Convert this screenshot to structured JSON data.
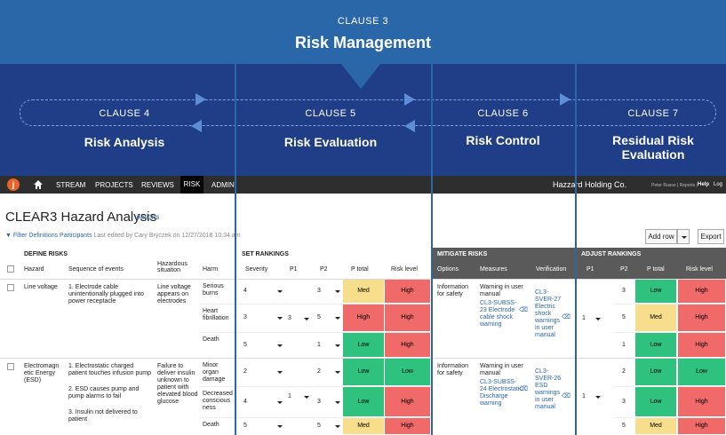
{
  "banner": {
    "clause_top": "CLAUSE 3",
    "title": "Risk Management",
    "clauses": [
      {
        "num": "CLAUSE 4",
        "name": "Risk Analysis"
      },
      {
        "num": "CLAUSE 5",
        "name": "Risk Evaluation"
      },
      {
        "num": "CLAUSE 6",
        "name": "Risk Control"
      },
      {
        "num": "CLAUSE 7",
        "name": "Residual Risk Evaluation"
      }
    ]
  },
  "nav": {
    "logo": "j",
    "items": [
      "STREAM",
      "PROJECTS",
      "REVIEWS",
      "RISK",
      "ADMIN"
    ],
    "company": "Hazzard Holding Co.",
    "user_links": "Peter Russo  |  Reports  |",
    "help": "Help",
    "log": "Log"
  },
  "page": {
    "title": "CLEAR3 Hazard Analysis",
    "actions": "Actions",
    "filter": "Filter",
    "definitions": "Definitions",
    "participants": "Participants",
    "last_edited": "Last edited by Cary Bryczek on 12/27/2018 10:34 am",
    "add_row": "Add row",
    "export": "Export"
  },
  "sections": {
    "define": "DEFINE RISKS",
    "set": "SET RANKINGS",
    "mitigate": "MITIGATE RISKS",
    "adjust": "ADJUST RANKINGS"
  },
  "columns": {
    "hazard": "Hazard",
    "sequence": "Sequence of events",
    "situation": "Hazardous situation",
    "harm": "Harm",
    "severity": "Severity",
    "p1": "P1",
    "p2": "P2",
    "ptotal": "P total",
    "risk_level": "Risk level",
    "options": "Options",
    "measures": "Measures",
    "verification": "Verification"
  },
  "colors": {
    "low": "#2ec27e",
    "med": "#f7de8c",
    "high": "#f06a6a"
  },
  "rows": [
    {
      "hazard": "Line voltage",
      "sequence": [
        "1. Electrode cable unintentionally plugged into power receptacle"
      ],
      "situation": "Line voltage appears on electrodes",
      "p1": "3",
      "option": "Information for safety",
      "measure_text": "Warning in user manual",
      "measure_link": "CL3-SUBSS-23 Electrode cable shock warning",
      "verification": "CL3-SVER-27 Electric shock warnings in user manual",
      "adj_p1": "1",
      "harms": [
        {
          "harm": "Serious burns",
          "sev": "4",
          "p2": "3",
          "pt": "Med",
          "rl": "High",
          "ap2": "3",
          "apt": "Low",
          "arl": "High"
        },
        {
          "harm": "Heart fibrillation",
          "sev": "3",
          "p2": "5",
          "pt": "High",
          "rl": "High",
          "ap2": "5",
          "apt": "Med",
          "arl": "High"
        },
        {
          "harm": "Death",
          "sev": "5",
          "p2": "1",
          "pt": "Low",
          "rl": "High",
          "ap2": "1",
          "apt": "Low",
          "arl": "High"
        }
      ]
    },
    {
      "hazard": "Electromagn etic Energy (ESD)",
      "sequence": [
        "1. Electrostatic charged patient touches infusion pump",
        "2. ESD causes pump and pump alarms to fail",
        "3. Insulin not delivered to patient"
      ],
      "situation": "Failure to deliver insulin unknown to patient with elevated blood glucose",
      "p1": "1",
      "option": "Information for safety",
      "measure_text": "Warning in user manual",
      "measure_link": "CL3-SUBSS-24 Electrostatic Discharge warning",
      "verification": "CL3-SVER-26 ESD warnings in user manual",
      "adj_p1": "1",
      "harms": [
        {
          "harm": "Minor organ damage",
          "sev": "2",
          "p2": "2",
          "pt": "Low",
          "rl": "Low",
          "ap2": "2",
          "apt": "Low",
          "arl": "Low"
        },
        {
          "harm": "Decreased conscious ness",
          "sev": "4",
          "p2": "3",
          "pt": "Low",
          "rl": "High",
          "ap2": "3",
          "apt": "Low",
          "arl": "High"
        },
        {
          "harm": "Death",
          "sev": "5",
          "p2": "5",
          "pt": "Med",
          "rl": "High",
          "ap2": "5",
          "apt": "Med",
          "arl": "High"
        }
      ]
    }
  ]
}
